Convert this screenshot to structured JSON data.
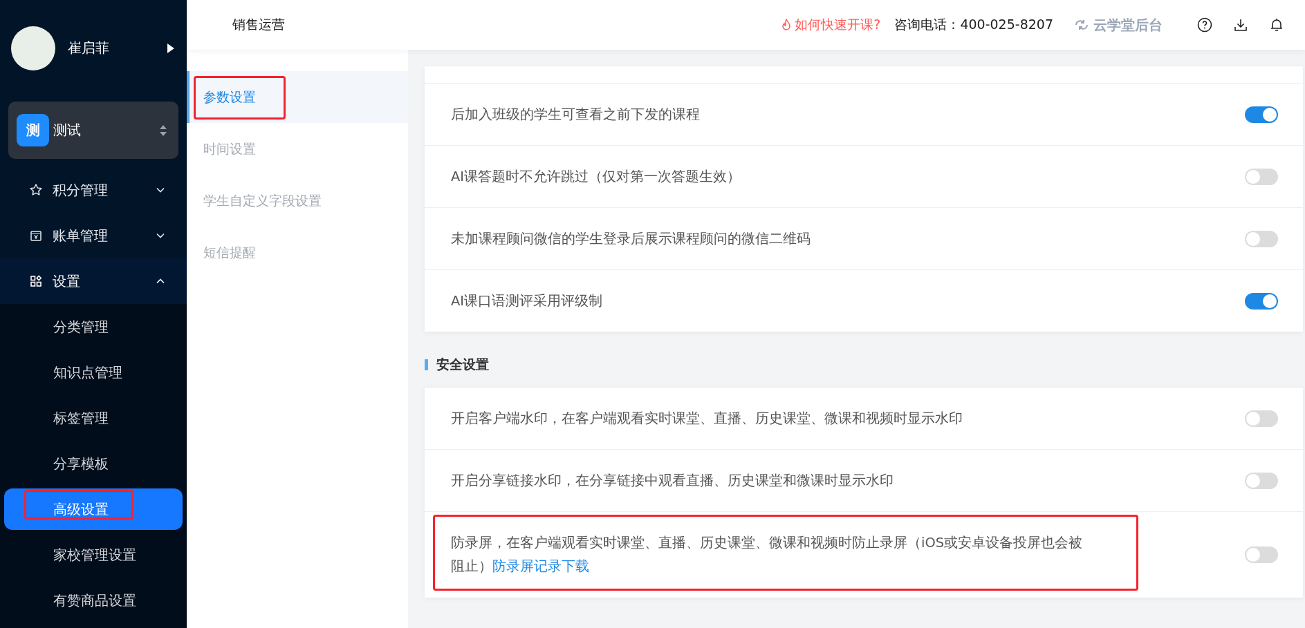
{
  "header": {
    "title": "销售运营",
    "help_link": "如何快速开课?",
    "phone": "咨询电话：400-025-8207",
    "brand": "云学堂后台"
  },
  "sidebar": {
    "user": {
      "name": "崔启菲"
    },
    "org": {
      "badge": "测",
      "name": "测试"
    },
    "menu": [
      {
        "label": "积分管理",
        "expanded": false
      },
      {
        "label": "账单管理",
        "expanded": false
      },
      {
        "label": "设置",
        "expanded": true,
        "children": [
          {
            "label": "分类管理",
            "selected": false,
            "annotated": false
          },
          {
            "label": "知识点管理",
            "selected": false,
            "annotated": false
          },
          {
            "label": "标签管理",
            "selected": false,
            "annotated": false
          },
          {
            "label": "分享模板",
            "selected": false,
            "annotated": false
          },
          {
            "label": "高级设置",
            "selected": true,
            "annotated": true
          },
          {
            "label": "家校管理设置",
            "selected": false,
            "annotated": false
          },
          {
            "label": "有赞商品设置",
            "selected": false,
            "annotated": false
          }
        ]
      }
    ]
  },
  "subnav": [
    {
      "label": "参数设置",
      "selected": true,
      "annotated": true
    },
    {
      "label": "时间设置",
      "selected": false,
      "annotated": false
    },
    {
      "label": "学生自定义字段设置",
      "selected": false,
      "annotated": false
    },
    {
      "label": "短信提醒",
      "selected": false,
      "annotated": false
    }
  ],
  "sections": [
    {
      "rows": [
        {
          "text": "后加入班级的学生可查看之前下发的课程",
          "on": true,
          "annotated": false
        },
        {
          "text": "AI课答题时不允许跳过（仅对第一次答题生效）",
          "on": false,
          "annotated": false
        },
        {
          "text": "未加课程顾问微信的学生登录后展示课程顾问的微信二维码",
          "on": false,
          "annotated": false
        },
        {
          "text": "AI课口语测评采用评级制",
          "on": true,
          "annotated": false
        }
      ]
    },
    {
      "title": "安全设置",
      "rows": [
        {
          "text": "开启客户端水印，在客户端观看实时课堂、直播、历史课堂、微课和视频时显示水印",
          "on": false,
          "annotated": false
        },
        {
          "text": "开启分享链接水印，在分享链接中观看直播、历史课堂和微课时显示水印",
          "on": false,
          "annotated": false
        },
        {
          "text": "防录屏，在客户端观看实时课堂、直播、历史课堂、微课和视频时防止录屏（iOS或安卓设备投屏也会被阻止）",
          "link": "防录屏记录下载",
          "on": false,
          "annotated": true
        }
      ]
    }
  ]
}
